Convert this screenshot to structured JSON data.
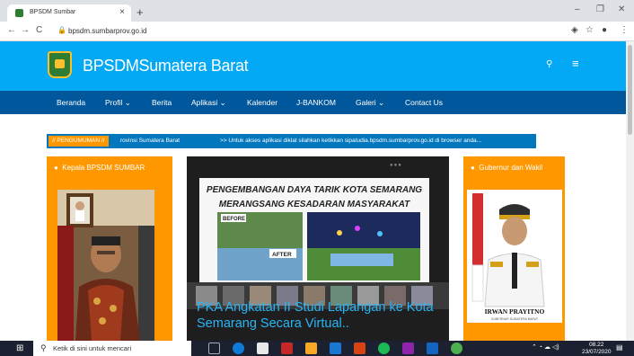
{
  "browser": {
    "tab_title": "BPSDM Sumbar",
    "tab_close": "×",
    "new_tab": "+",
    "url": "bpsdm.sumbarprov.go.id",
    "win_minimize": "–",
    "win_restore": "❐",
    "win_close": "✕",
    "back": "←",
    "forward": "→",
    "reload": "C"
  },
  "site": {
    "title_bold": "BPSDM",
    "title_rest": "Sumatera Barat",
    "search_icon": "🔍",
    "menu_icon": "☰"
  },
  "nav": {
    "items": [
      {
        "label": "Beranda"
      },
      {
        "label": "Profil ⌄"
      },
      {
        "label": "Berita"
      },
      {
        "label": "Aplikasi ⌄"
      },
      {
        "label": "Kalender"
      },
      {
        "label": "J-BANKOM"
      },
      {
        "label": "Galeri ⌄"
      },
      {
        "label": "Contact Us"
      }
    ]
  },
  "announcement": {
    "label": "// PENGUMUMAN //",
    "text_1": "rovinsi Sumatera Barat",
    "text_2": ">> Untuk akses aplikasi diklat silahkan ketikkan sipatudia.bpsdm.sumbarprov.go.id di browser anda..."
  },
  "left_panel": {
    "title": "Kepala BPSDM SUMBAR"
  },
  "right_panel": {
    "title": "Gubernur dan Wakil",
    "photo_caption": "IRWAN PRAYITNO",
    "photo_subcaption": "GUBERNUR SUMATERA BARAT"
  },
  "slider": {
    "headline_1": "PENGEMBANGAN DAYA TARIK KOTA SEMARANG",
    "headline_2": "MERANGSANG KESADARAN MASYARAKAT",
    "before": "BEFORE",
    "after": "AFTER",
    "caption": "PKA Angkatan II Studi Lapangan ke Kota Semarang Secara Virtual.."
  },
  "taskbar": {
    "search_placeholder": "Ketik di sini untuk mencari",
    "time": "08.22",
    "date": "23/07/2020"
  }
}
